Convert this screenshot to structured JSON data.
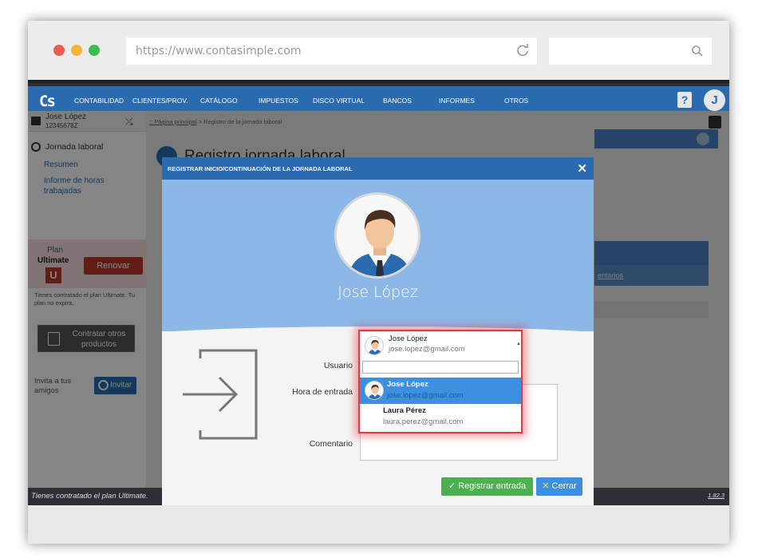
{
  "browser": {
    "url": "https://www.contasimple.com",
    "reload_icon": "reload-icon",
    "search_icon": "search-icon",
    "dots": [
      "#e74c3c",
      "#f39c12",
      "#27ae60"
    ]
  },
  "nav": {
    "logo": "Cs",
    "items": [
      "CONTABILIDAD",
      "CLIENTES/PROV.",
      "CATÁLOGO",
      "IMPUESTOS",
      "DISCO VIRTUAL",
      "BANCOS",
      "INFORMES",
      "OTROS"
    ],
    "help": "?",
    "avatar_letter": "J"
  },
  "sidebar": {
    "user_name": "Jose López",
    "user_nif": "12345678Z",
    "section_title": "Jornada laboral",
    "links": [
      "Resumen",
      "Informe de horas trabajadas"
    ],
    "plan_label": "Plan",
    "plan_name": "Ultimate",
    "plan_badge": "U",
    "renew_label": "Renovar",
    "plan_note": "Tienes contratado el plan Ultimate. Tu plan no expira.",
    "buy_label": "Contratar otros productos",
    "invite_text": "Invita a tus amigos",
    "invite_label": "Invitar"
  },
  "main": {
    "breadcrumb_link": ":: Página principal",
    "breadcrumb_rest": " > Registro de la jornada laboral",
    "page_title": "Registro jornada laboral",
    "table_sub_label": "entarios"
  },
  "footer": {
    "text": "Tienes contratado el plan Ultimate.",
    "version": "1.82.3"
  },
  "modal": {
    "title": "REGISTRAR INICIO/CONTINUACIÓN DE LA JORNADA LABORAL",
    "hero_name": "Jose López",
    "labels": {
      "user": "Usuario",
      "start_time": "Hora de entrada",
      "comment": "Comentario"
    },
    "submit_label": "✓ Registrar entrada",
    "cancel_label": "✕ Cerrar"
  },
  "dropdown": {
    "selected": {
      "name": "Jose López",
      "email": "jose.lopez@gmail.com"
    },
    "search_value": "",
    "options": [
      {
        "name": "Jose López",
        "email": "jose.lopez@gmail.com",
        "highlighted": true
      },
      {
        "name": "Laura Pérez",
        "email": "laura.perez@gmail.com",
        "highlighted": false
      }
    ]
  }
}
